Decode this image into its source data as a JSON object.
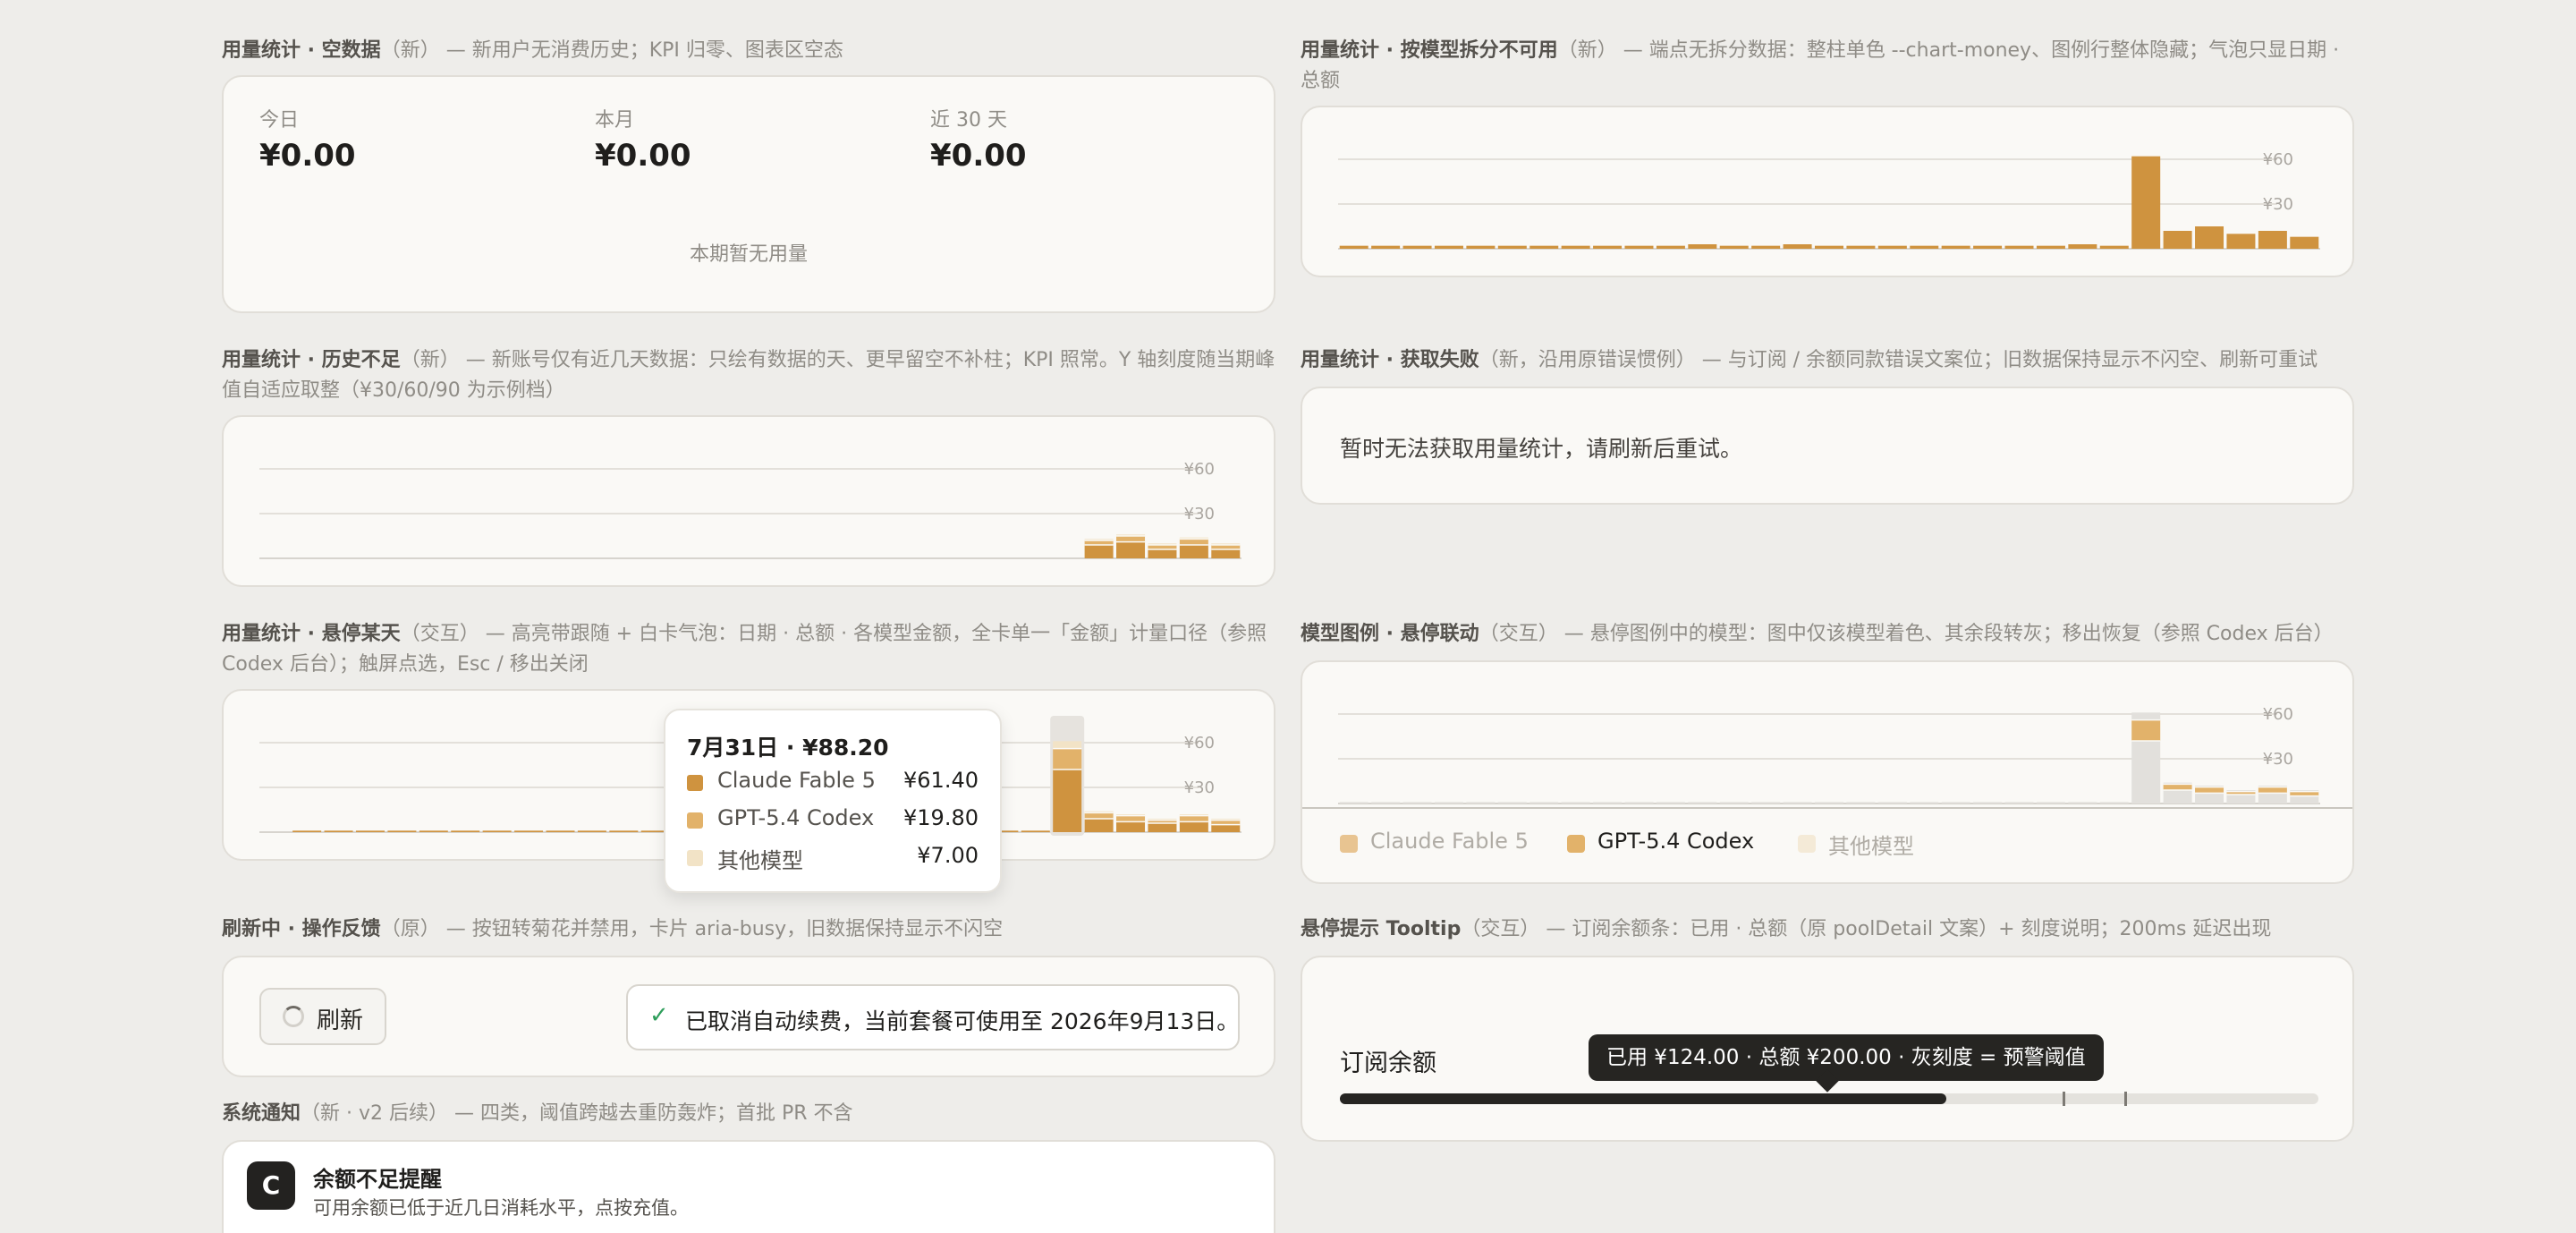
{
  "sections": {
    "empty": {
      "title": "用量统计 · 空数据",
      "tag": "（新）",
      "desc": " — 新用户无消费历史；KPI 归零、图表区空态"
    },
    "no_split": {
      "title": "用量统计 · 按模型拆分不可用",
      "tag": "（新）",
      "desc": " — 端点无拆分数据：整柱单色 --chart-money、图例行整体隐藏；气泡只显日期 · 总额"
    },
    "history": {
      "title": "用量统计 · 历史不足",
      "tag": "（新）",
      "desc": " — 新账号仅有近几天数据：只绘有数据的天、更早留空不补柱；KPI 照常。Y 轴刻度随当期峰值自适应取整（¥30/60/90 为示例档）"
    },
    "fetch_fail": {
      "title": "用量统计 · 获取失败",
      "tag": "（新，沿用原错误惯例）",
      "desc": " — 与订阅 / 余额同款错误文案位；旧数据保持显示不闪空、刷新可重试"
    },
    "hover_day": {
      "title": "用量统计 · 悬停某天",
      "tag": "（交互）",
      "desc": " — 高亮带跟随 + 白卡气泡：日期 · 总额 · 各模型金额，全卡单一「金额」计量口径（参照 Codex 后台）；触屏点选，Esc / 移出关闭"
    },
    "legend_hover": {
      "title": "模型图例 · 悬停联动",
      "tag": "（交互）",
      "desc": " — 悬停图例中的模型：图中仅该模型着色、其余段转灰；移出恢复（参照 Codex 后台）"
    },
    "refreshing": {
      "title": "刷新中 · 操作反馈",
      "tag": "（原）",
      "desc": " — 按钮转菊花并禁用，卡片 aria-busy，旧数据保持显示不闪空"
    },
    "hover_tip": {
      "title": "悬停提示 Tooltip",
      "tag": "（交互）",
      "desc": " — 订阅余额条：已用 · 总额（原 poolDetail 文案）+ 刻度说明；200ms 延迟出现"
    },
    "notify": {
      "title": "系统通知",
      "tag": "（新 · v2 后续）",
      "desc": " — 四类，阈值跨越去重防轰炸；首批 PR 不含"
    }
  },
  "kpi": [
    {
      "label": "今日",
      "value": "¥0.00"
    },
    {
      "label": "本月",
      "value": "¥0.00"
    },
    {
      "label": "近 30 天",
      "value": "¥0.00"
    }
  ],
  "empty_message": "本期暂无用量",
  "axis_ticks": {
    "t60": "¥60",
    "t30": "¥30"
  },
  "fetch_error": "暂时无法获取用量统计，请刷新后重试。",
  "colors": {
    "claude": "#cf933f",
    "gpt": "#e2b26a",
    "other": "#f2e3c6",
    "grey": "#e2e0dc",
    "money": "#cf933f"
  },
  "hover_tooltip": {
    "title": "7月31日 · ¥88.20",
    "rows": [
      {
        "name": "Claude Fable 5",
        "value": "¥61.40"
      },
      {
        "name": "GPT-5.4 Codex",
        "value": "¥19.80"
      },
      {
        "name": "其他模型",
        "value": "¥7.00"
      }
    ]
  },
  "legend": [
    "Claude Fable 5",
    "GPT-5.4 Codex",
    "其他模型"
  ],
  "refresh_label": "刷新",
  "toast_text": "已取消自动续费，当前套餐可使用至 2026年9月13日。",
  "subscription": {
    "label": "订阅余额",
    "tooltip": "已用 ¥124.00 · 总额 ¥200.00 · 灰刻度 = 预警阈值",
    "used": 124,
    "total": 200
  },
  "notification": {
    "avatar": "C",
    "title": "余额不足提醒",
    "body": "可用余额已低于近几日消耗水平，点按充值。"
  },
  "chart_data": [
    {
      "type": "bar",
      "title": "用量统计 · 按模型拆分不可用",
      "ylim": [
        0,
        70
      ],
      "yticks": [
        "¥30",
        "¥60"
      ],
      "series": [
        {
          "values": [
            2,
            2,
            2,
            2,
            2,
            2,
            2,
            2,
            2,
            2,
            2,
            3,
            2,
            2,
            3,
            2,
            2,
            2,
            2,
            2,
            2,
            2,
            2,
            3,
            2,
            62,
            12,
            15,
            10,
            12,
            8
          ]
        }
      ]
    },
    {
      "type": "bar",
      "title": "用量统计 · 历史不足",
      "ylim": [
        0,
        70
      ],
      "yticks": [
        "¥30",
        "¥60"
      ],
      "series": [
        {
          "name": "Claude Fable 5",
          "values": [
            9,
            11,
            6,
            9,
            6
          ]
        },
        {
          "name": "GPT-5.4 Codex",
          "values": [
            3,
            4,
            3,
            4,
            3
          ]
        },
        {
          "name": "其他模型",
          "values": [
            1,
            1,
            1,
            1,
            1
          ]
        }
      ]
    },
    {
      "type": "bar",
      "title": "用量统计 · 悬停某天",
      "ylim": [
        0,
        70
      ],
      "yticks": [
        "¥30",
        "¥60"
      ],
      "highlight_index": 24,
      "series": [
        {
          "name": "Claude Fable 5",
          "values": [
            1,
            1,
            1,
            1,
            1,
            1,
            1,
            1,
            1,
            1,
            1,
            1,
            1,
            1,
            1,
            1,
            1,
            1,
            1,
            1,
            1,
            1,
            1,
            1,
            42,
            9,
            7,
            6,
            7,
            5
          ]
        },
        {
          "name": "GPT-5.4 Codex",
          "values": [
            0,
            0,
            0,
            0,
            0,
            0,
            0,
            0,
            0,
            0,
            0,
            0,
            0,
            0,
            0,
            0,
            0,
            0,
            0,
            0,
            0,
            0,
            0,
            0,
            14,
            4,
            4,
            2,
            4,
            3
          ]
        },
        {
          "name": "其他模型",
          "values": [
            0,
            0,
            0,
            0,
            0,
            0,
            0,
            0,
            0,
            0,
            0,
            0,
            0,
            0,
            0,
            0,
            0,
            0,
            0,
            0,
            0,
            0,
            0,
            0,
            5,
            1,
            1,
            1,
            1,
            1
          ]
        }
      ]
    },
    {
      "type": "bar",
      "title": "模型图例 · 悬停联动",
      "ylim": [
        0,
        70
      ],
      "yticks": [
        "¥30",
        "¥60"
      ],
      "focus_series": "GPT-5.4 Codex",
      "series": [
        {
          "name": "Claude Fable 5",
          "values": [
            1,
            1,
            1,
            1,
            1,
            1,
            1,
            1,
            1,
            1,
            1,
            1,
            1,
            1,
            1,
            1,
            1,
            1,
            1,
            1,
            1,
            1,
            1,
            1,
            1,
            42,
            9,
            7,
            6,
            7,
            5
          ]
        },
        {
          "name": "GPT-5.4 Codex",
          "values": [
            0,
            0,
            0,
            0,
            0,
            0,
            0,
            0,
            0,
            0,
            0,
            0,
            0,
            0,
            0,
            0,
            0,
            0,
            0,
            0,
            0,
            0,
            0,
            0,
            0,
            14,
            4,
            4,
            2,
            4,
            3
          ]
        },
        {
          "name": "其他模型",
          "values": [
            0,
            0,
            0,
            0,
            0,
            0,
            0,
            0,
            0,
            0,
            0,
            0,
            0,
            0,
            0,
            0,
            0,
            0,
            0,
            0,
            0,
            0,
            0,
            0,
            0,
            5,
            1,
            1,
            1,
            1,
            1
          ]
        }
      ]
    }
  ]
}
